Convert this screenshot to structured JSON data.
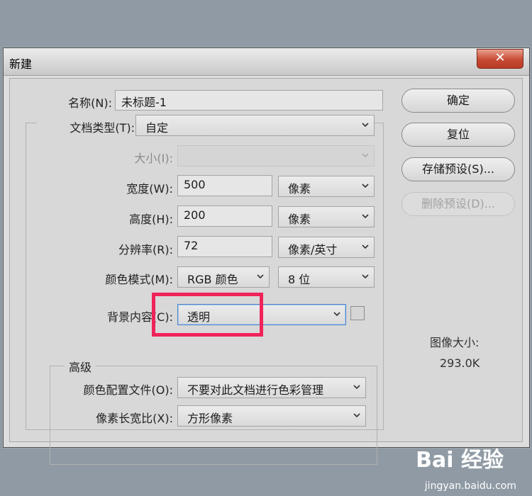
{
  "window": {
    "title": "新建",
    "close_glyph": "✕"
  },
  "form": {
    "name": {
      "label": "名称(N):",
      "value": "未标题-1"
    },
    "doc_type": {
      "label": "文档类型(T):",
      "value": "自定"
    },
    "size": {
      "label": "大小(I):",
      "value": ""
    },
    "width": {
      "label": "宽度(W):",
      "value": "500",
      "unit": "像素"
    },
    "height": {
      "label": "高度(H):",
      "value": "200",
      "unit": "像素"
    },
    "resolution": {
      "label": "分辨率(R):",
      "value": "72",
      "unit": "像素/英寸"
    },
    "color_mode": {
      "label": "颜色模式(M):",
      "value": "RGB 颜色",
      "depth": "8 位"
    },
    "background": {
      "label": "背景内容(C):",
      "value": "透明"
    }
  },
  "advanced": {
    "title": "高级",
    "color_profile": {
      "label": "颜色配置文件(O):",
      "value": "不要对此文档进行色彩管理"
    },
    "pixel_aspect": {
      "label": "像素长宽比(X):",
      "value": "方形像素"
    }
  },
  "buttons": {
    "ok": "确定",
    "reset": "复位",
    "save_preset": "存储预设(S)...",
    "delete_preset": "删除预设(D)..."
  },
  "info": {
    "image_size_label": "图像大小:",
    "image_size_value": "293.0K"
  },
  "watermark": {
    "brand": "Bai 经验",
    "url": "jingyan.baidu.com"
  },
  "colors": {
    "highlight": "#f0245a",
    "focus": "#4d86c8",
    "close": "#c74a33"
  }
}
